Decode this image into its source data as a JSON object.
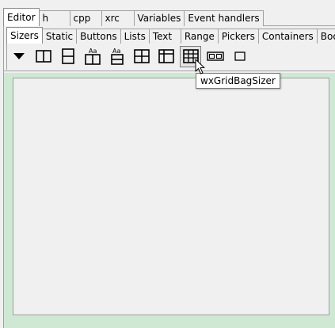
{
  "main_tabs": [
    {
      "label": "Editor",
      "active": true
    },
    {
      "label": "h",
      "active": false
    },
    {
      "label": "cpp",
      "active": false
    },
    {
      "label": "xrc",
      "active": false
    },
    {
      "label": "Variables",
      "active": false
    },
    {
      "label": "Event handlers",
      "active": false
    }
  ],
  "palette_tabs": [
    {
      "label": "Sizers",
      "active": true
    },
    {
      "label": "Static",
      "active": false
    },
    {
      "label": "Buttons",
      "active": false
    },
    {
      "label": "Lists",
      "active": false
    },
    {
      "label": "Text",
      "active": false
    },
    {
      "label": "Range",
      "active": false
    },
    {
      "label": "Pickers",
      "active": false
    },
    {
      "label": "Containers",
      "active": false
    },
    {
      "label": "Boo",
      "active": false
    }
  ],
  "toolbar": {
    "icons": [
      "dropdown-arrow-icon",
      "horizontal-box-sizer-icon",
      "vertical-box-sizer-icon",
      "horizontal-static-box-sizer-icon",
      "vertical-static-box-sizer-icon",
      "grid-sizer-icon",
      "flex-grid-sizer-icon",
      "grid-bag-sizer-icon",
      "std-dialog-button-sizer-icon",
      "spacer-icon"
    ],
    "static_box_label": "Aa",
    "hovered": "grid-bag-sizer-icon"
  },
  "tooltip": {
    "text": "wxGridBagSizer"
  },
  "colors": {
    "design_area": "#cfe8d3",
    "panel": "#f0f0f0",
    "tab_active": "#ffffff"
  }
}
